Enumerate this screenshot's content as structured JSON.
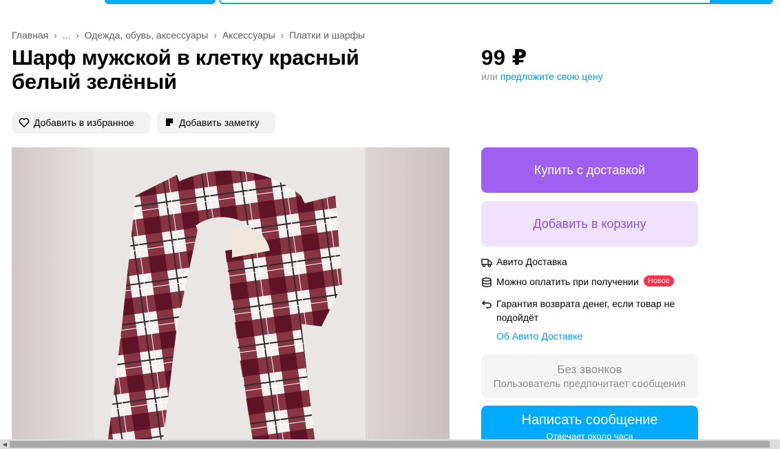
{
  "breadcrumb": [
    "Главная",
    "...",
    "Одежда, обувь, аксессуары",
    "Аксессуары",
    "Платки и шарфы"
  ],
  "title": "Шарф мужской в клетку красный белый зелёный",
  "actions": {
    "favorite": "Добавить в избранное",
    "note": "Добавить заметку"
  },
  "price": {
    "value": "99 ₽",
    "or": "или",
    "offer_link": "предложите свою цену"
  },
  "buttons": {
    "buy": "Купить с доставкой",
    "cart": "Добавить в корзину",
    "calls_title": "Без звонков",
    "calls_sub": "Пользователь предпочитает сообщения",
    "message": "Написать сообщение",
    "message_sub": "Отвечает около часа"
  },
  "features": {
    "delivery": "Авито Доставка",
    "payment": "Можно оплатить при получении",
    "payment_badge": "Новое",
    "guarantee": "Гарантия возврата денег, если товар не подойдёт",
    "about_link": "Об Авито Доставке"
  },
  "colors": {
    "accent": "#00aaff",
    "buy": "#9f60f2",
    "cart_bg": "#efe2fd",
    "link": "#0099f7",
    "badge": "#ff3045",
    "scarf_red": "#7d1f33",
    "scarf_white": "#f4f1ee"
  }
}
